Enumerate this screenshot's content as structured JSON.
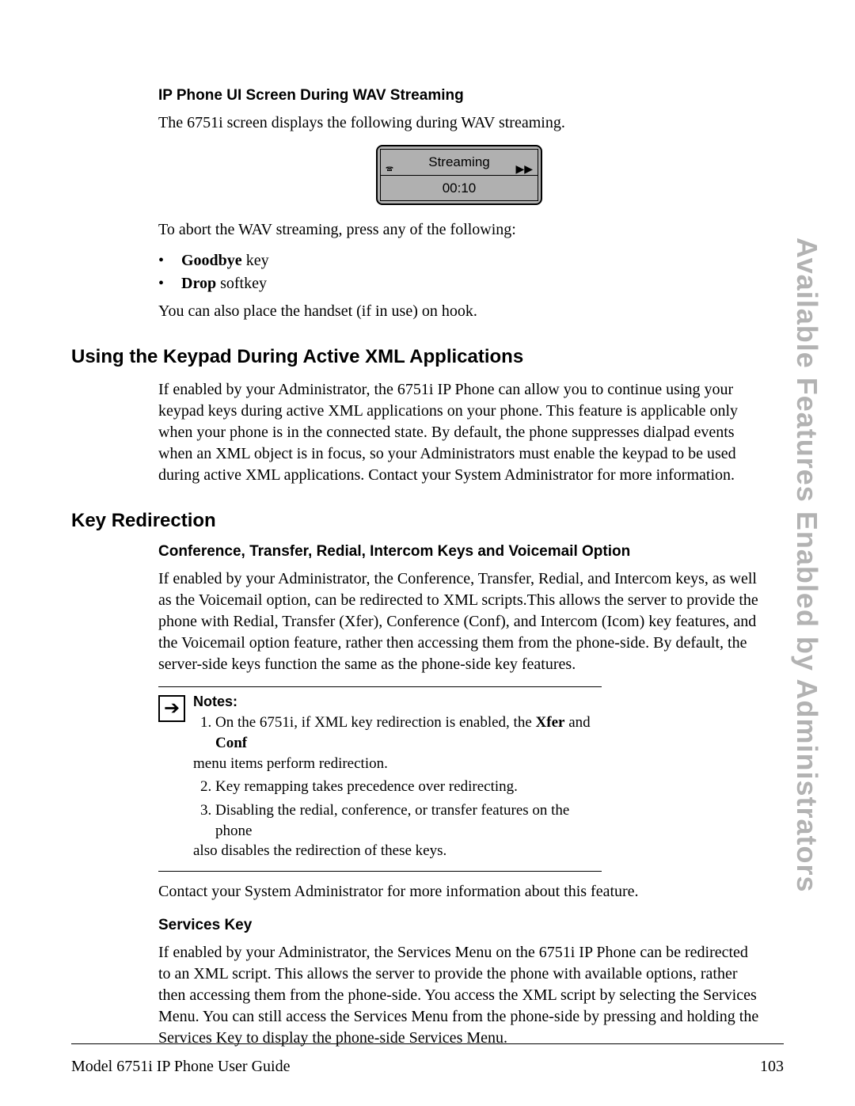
{
  "side_title": "Available Features Enabled by Administrators",
  "wav": {
    "heading": "IP Phone UI Screen During WAV Streaming",
    "intro": "The 6751i screen displays the following during WAV streaming.",
    "lcd_line1": "Streaming",
    "lcd_time": "00:10",
    "abort": "To abort the WAV streaming, press any of the following:",
    "goodbye_bold": "Goodbye",
    "goodbye_rest": " key",
    "drop_bold": "Drop",
    "drop_rest": " softkey",
    "handset": "You can also place the handset (if in use) on hook."
  },
  "keypad": {
    "heading": "Using the Keypad During Active XML Applications",
    "body": "If enabled by your Administrator, the 6751i IP Phone can allow you to continue using your keypad keys during active XML applications on your phone. This feature is applicable only when your phone is in the connected state. By default, the phone suppresses dialpad events when an XML object is in focus, so your Administrators must enable the keypad to be used during active XML applications. Contact your System Administrator for more information."
  },
  "redirect": {
    "heading": "Key Redirection",
    "subhead": "Conference, Transfer, Redial, Intercom Keys and Voicemail Option",
    "body": "If enabled by your Administrator, the Conference, Transfer, Redial, and Intercom keys, as well as the Voicemail option, can be redirected to XML scripts.This allows the server to provide the phone with Redial, Transfer (Xfer), Conference (Conf), and Intercom (Icom) key features, and the Voicemail option feature, rather then accessing them from the phone-side. By default, the server-side keys function the same as the phone-side key features.",
    "notes_title": "Notes:",
    "note1_pre": "On the 6751i, if XML key redirection is enabled, the ",
    "note1_b1": "Xfer",
    "note1_mid": " and ",
    "note1_b2": "Conf",
    "note1_post_line": "menu items perform redirection.",
    "note2": "Key remapping takes precedence over redirecting.",
    "note3_a": "Disabling the redial, conference, or transfer features on the phone",
    "note3_b": "also disables the redirection of these keys.",
    "contact": "Contact your System Administrator for more information about this feature.",
    "services_heading": "Services Key",
    "services_body": "If enabled by your Administrator, the Services Menu on the 6751i IP Phone can be redirected to an XML script. This allows the server to provide the phone with available options, rather then accessing them from the phone-side. You access the XML script by selecting the Services Menu. You can still access the Services Menu from the phone-side by pressing and holding the Services Key to display the phone-side Services Menu."
  },
  "footer": {
    "left": "Model 6751i IP Phone User Guide",
    "page": "103"
  }
}
